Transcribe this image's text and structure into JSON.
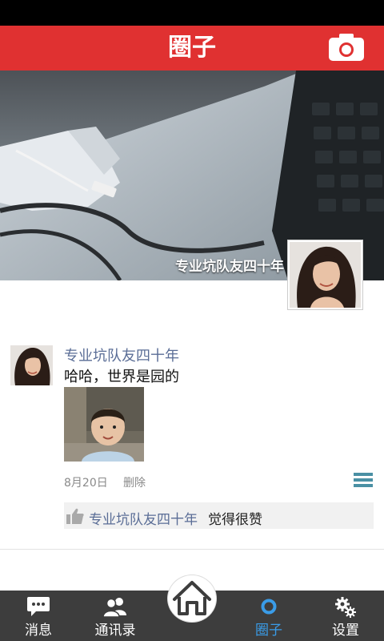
{
  "header": {
    "title": "圈子",
    "camera_icon": "camera-icon"
  },
  "cover": {
    "name": "专业坑队友四十年"
  },
  "post": {
    "author": "专业坑队友四十年",
    "text": "哈哈，世界是园的",
    "date": "8月20日",
    "delete_label": "删除",
    "like": {
      "name": "专业坑队友四十年",
      "suffix": "觉得很赞"
    }
  },
  "tabs": [
    {
      "label": "消息",
      "icon": "chat-icon",
      "active": false
    },
    {
      "label": "通讯录",
      "icon": "contacts-icon",
      "active": false
    },
    {
      "label": "圈子",
      "icon": "circle-icon",
      "active": true
    },
    {
      "label": "设置",
      "icon": "gears-icon",
      "active": false
    }
  ],
  "home_icon": "home-icon",
  "colors": {
    "title_bar": "#e03131",
    "tab_bar": "#3d3d3d",
    "active_tab": "#3a9ce8",
    "link": "#5a6d96"
  }
}
